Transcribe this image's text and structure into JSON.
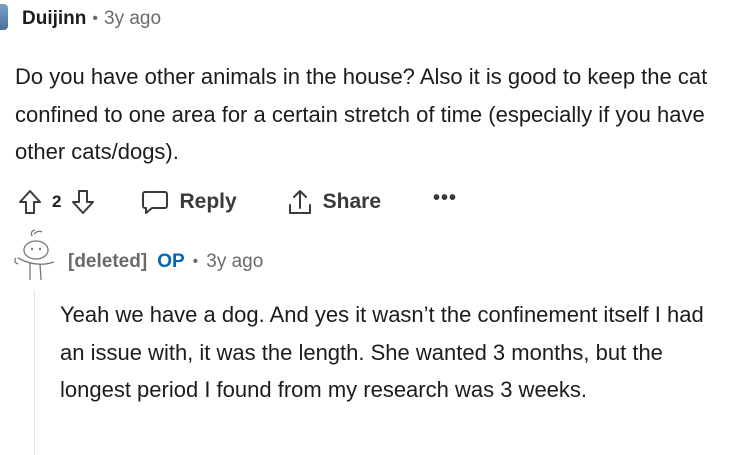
{
  "comment1": {
    "author": "Duijinn",
    "separator": "•",
    "time": "3y ago",
    "body": "Do you have other animals in the house? Also it is good to keep the cat confined to one area for a certain stretch of time (especially if you have other cats/dogs).",
    "score": "2",
    "reply_label": "Reply",
    "share_label": "Share",
    "more_label": "•••"
  },
  "comment2": {
    "author": "[deleted]",
    "op_badge": "OP",
    "separator": "•",
    "time": "3y ago",
    "body": "Yeah we have a dog. And yes it wasn’t the confinement itself I had an issue with, it was the length. She wanted 3 months, but the longest period I found from my research was 3 weeks."
  },
  "colors": {
    "text": "#1c1c1c",
    "meta": "#6a6a6a",
    "op_blue": "#0a64b4"
  },
  "icons": [
    "upvote-icon",
    "downvote-icon",
    "reply-icon",
    "share-icon",
    "more-icon",
    "snoo-avatar-icon"
  ]
}
